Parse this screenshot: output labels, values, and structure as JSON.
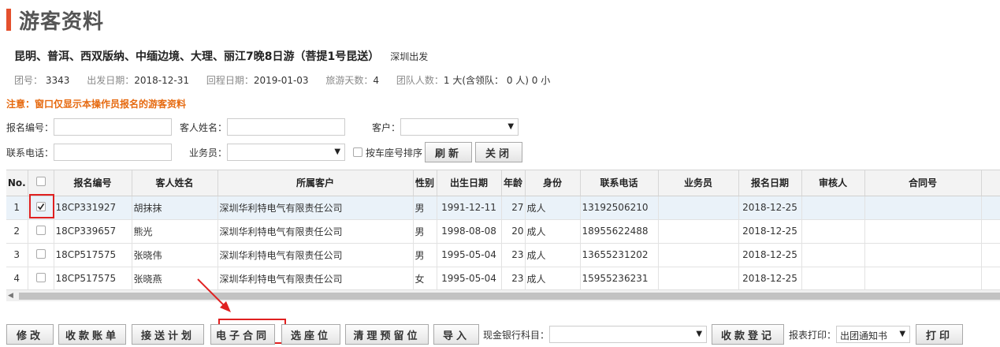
{
  "page_title": "游客资料",
  "tour": {
    "name": "昆明、普洱、西双版纳、中缅边境、大理、丽江7晚8日游（菩提1号昆送）",
    "departure": "深圳出发"
  },
  "info": {
    "group_no_label": "团号：",
    "group_no": "3343",
    "depart_label": "出发日期：",
    "depart_date": "2018-12-31",
    "return_label": "回程日期：",
    "return_date": "2019-01-03",
    "days_label": "旅游天数：",
    "days": "4",
    "people_label": "团队人数：",
    "people": "1 大(含领队： 0 人) 0 小"
  },
  "notice": "注意：窗口仅显示本操作员报名的游客资料",
  "filters": {
    "reg_no_label": "报名编号：",
    "reg_no_value": "",
    "guest_name_label": "客人姓名：",
    "guest_name_value": "",
    "customer_label": "客户：",
    "customer_value": "",
    "phone_label": "联系电话：",
    "phone_value": "",
    "salesman_label": "业务员：",
    "salesman_value": "",
    "seat_sort_label": "按车座号排序",
    "refresh_label": "刷新",
    "close_label": "关闭"
  },
  "table": {
    "headers": [
      "No.",
      "",
      "报名编号",
      "客人姓名",
      "所属客户",
      "性别",
      "出生日期",
      "年龄",
      "身份",
      "联系电话",
      "业务员",
      "报名日期",
      "审核人",
      "合同号",
      ""
    ],
    "rows": [
      {
        "no": "1",
        "checked": true,
        "reg_no": "18CP331927",
        "name": "胡抹抹",
        "customer": "深圳华利特电气有限责任公司",
        "gender": "男",
        "birth": "1991-12-11",
        "age": "27",
        "identity": "成人",
        "phone": "13192506210",
        "salesman": "",
        "reg_date": "2018-12-25",
        "reviewer": "",
        "contract": ""
      },
      {
        "no": "2",
        "checked": false,
        "reg_no": "18CP339657",
        "name": "熊光",
        "customer": "深圳华利特电气有限责任公司",
        "gender": "男",
        "birth": "1998-08-08",
        "age": "20",
        "identity": "成人",
        "phone": "18955622488",
        "salesman": "",
        "reg_date": "2018-12-25",
        "reviewer": "",
        "contract": ""
      },
      {
        "no": "3",
        "checked": false,
        "reg_no": "18CP517575",
        "name": "张晓伟",
        "customer": "深圳华利特电气有限责任公司",
        "gender": "男",
        "birth": "1995-05-04",
        "age": "23",
        "identity": "成人",
        "phone": "13655231202",
        "salesman": "",
        "reg_date": "2018-12-25",
        "reviewer": "",
        "contract": ""
      },
      {
        "no": "4",
        "checked": false,
        "reg_no": "18CP517575",
        "name": "张晓燕",
        "customer": "深圳华利特电气有限责任公司",
        "gender": "女",
        "birth": "1995-05-04",
        "age": "23",
        "identity": "成人",
        "phone": "15955236231",
        "salesman": "",
        "reg_date": "2018-12-25",
        "reviewer": "",
        "contract": ""
      }
    ]
  },
  "toolbar": {
    "modify": "修改",
    "receipt_bill": "收款账单",
    "transfer_plan": "接送计划",
    "e_contract": "电子合同",
    "select_seat": "选座位",
    "clear_reserved": "清理预留位",
    "import": "导入",
    "cash_bank_label": "现金银行科目：",
    "cash_bank_value": "",
    "receipt_register": "收款登记",
    "report_print_label": "报表打印：",
    "report_print_value": "出团通知书",
    "print": "打印"
  },
  "colors": {
    "accent": "#e4502d",
    "notice": "#e66a10",
    "highlight_box": "#e02020",
    "selected_row": "#eaf2f9"
  }
}
